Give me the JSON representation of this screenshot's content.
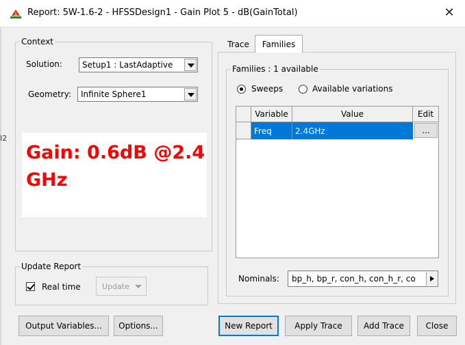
{
  "window": {
    "title": "Report: 5W-1.6-2 - HFSSDesign1 - Gain Plot 5 - dB(GainTotal)",
    "close_glyph": "✕",
    "edge_fragment": "I2"
  },
  "context": {
    "legend": "Context",
    "solution_label": "Solution:",
    "solution_value": "Setup1 : LastAdaptive",
    "geometry_label": "Geometry:",
    "geometry_value": "Infinite Sphere1"
  },
  "annotation": {
    "text": "Gain: 0.6dB @2.4 GHz",
    "color": "#ff0000"
  },
  "update_report": {
    "legend": "Update Report",
    "realtime_label": "Real time",
    "realtime_checked": true,
    "update_label": "Update"
  },
  "tabs": [
    {
      "label": "Trace",
      "active": false
    },
    {
      "label": "Families",
      "active": true
    }
  ],
  "families": {
    "legend": "Families : 1 available",
    "radio_sweeps": "Sweeps",
    "radio_variations": "Available variations",
    "selected_radio": "Sweeps",
    "columns": [
      "Variable",
      "Value",
      "Edit"
    ],
    "rows": [
      {
        "variable": "Freq",
        "value": "2.4GHz",
        "edit": "..."
      }
    ],
    "nominals_label": "Nominals:",
    "nominals_value": "bp_h, bp_r, con_h, con_h_r, co"
  },
  "buttons": {
    "output_variables": "Output Variables...",
    "options": "Options...",
    "new_report": "New Report",
    "apply_trace": "Apply Trace",
    "add_trace": "Add Trace",
    "close": "Close"
  },
  "colors": {
    "selection": "#0078d7",
    "default_button_border": "#0078d7"
  }
}
